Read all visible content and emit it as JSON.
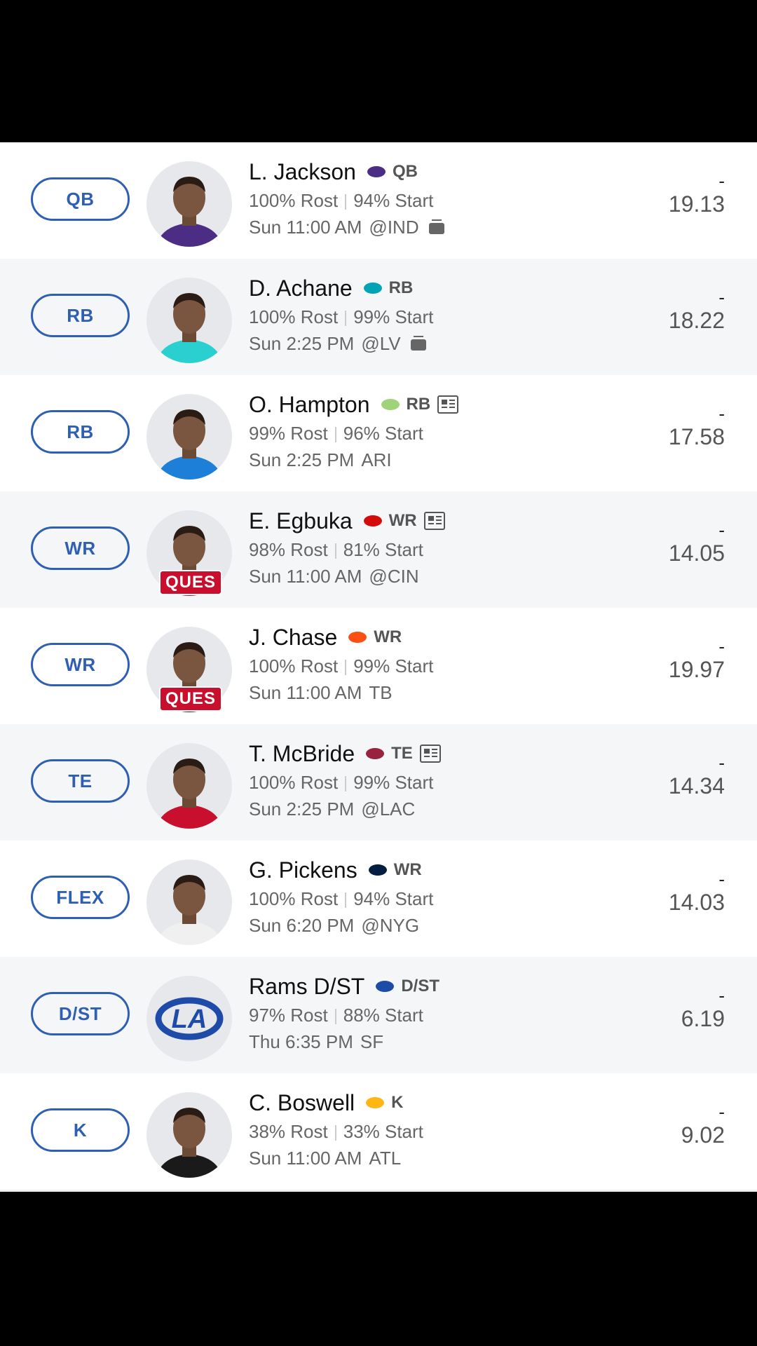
{
  "players": [
    {
      "slot": "QB",
      "name": "L. Jackson",
      "team_icon": "ravens-logo-icon",
      "team_color": "#4b2e83",
      "pos": "QB",
      "news": false,
      "rost": "100% Rost",
      "start": "94% Start",
      "time": "Sun 11:00 AM",
      "opp": "@IND",
      "tv": true,
      "status": "",
      "dash": "-",
      "proj": "19.13",
      "jersey": "#4b2e83"
    },
    {
      "slot": "RB",
      "name": "D. Achane",
      "team_icon": "dolphins-logo-icon",
      "team_color": "#00a4b4",
      "pos": "RB",
      "news": false,
      "rost": "100% Rost",
      "start": "99% Start",
      "time": "Sun 2:25 PM",
      "opp": "@LV",
      "tv": true,
      "status": "",
      "dash": "-",
      "proj": "18.22",
      "jersey": "#2ad0d0"
    },
    {
      "slot": "RB",
      "name": "O. Hampton",
      "team_icon": "chargers-logo-icon",
      "team_color": "#9fd37a",
      "pos": "RB",
      "news": true,
      "rost": "99% Rost",
      "start": "96% Start",
      "time": "Sun 2:25 PM",
      "opp": "ARI",
      "tv": false,
      "status": "",
      "dash": "-",
      "proj": "17.58",
      "jersey": "#1e7fd8"
    },
    {
      "slot": "WR",
      "name": "E. Egbuka",
      "team_icon": "buccaneers-logo-icon",
      "team_color": "#d50a0a",
      "pos": "WR",
      "news": true,
      "rost": "98% Rost",
      "start": "81% Start",
      "time": "Sun 11:00 AM",
      "opp": "@CIN",
      "tv": false,
      "status": "QUES",
      "dash": "-",
      "proj": "14.05",
      "jersey": "#b5121b"
    },
    {
      "slot": "WR",
      "name": "J. Chase",
      "team_icon": "bengals-logo-icon",
      "team_color": "#fb4f14",
      "pos": "WR",
      "news": false,
      "rost": "100% Rost",
      "start": "99% Start",
      "time": "Sun 11:00 AM",
      "opp": "TB",
      "tv": false,
      "status": "QUES",
      "dash": "-",
      "proj": "19.97",
      "jersey": "#222222"
    },
    {
      "slot": "TE",
      "name": "T. McBride",
      "team_icon": "cardinals-logo-icon",
      "team_color": "#97233f",
      "pos": "TE",
      "news": true,
      "rost": "100% Rost",
      "start": "99% Start",
      "time": "Sun 2:25 PM",
      "opp": "@LAC",
      "tv": false,
      "status": "",
      "dash": "-",
      "proj": "14.34",
      "jersey": "#c8102e"
    },
    {
      "slot": "FLEX",
      "name": "G. Pickens",
      "team_icon": "cowboys-star-icon",
      "team_color": "#041e42",
      "pos": "WR",
      "news": false,
      "rost": "100% Rost",
      "start": "94% Start",
      "time": "Sun 6:20 PM",
      "opp": "@NYG",
      "tv": false,
      "status": "",
      "dash": "-",
      "proj": "14.03",
      "jersey": "#f0f0f0"
    },
    {
      "slot": "D/ST",
      "name": "Rams D/ST",
      "team_icon": "rams-logo-icon",
      "team_color": "#1e4ba8",
      "pos": "D/ST",
      "news": false,
      "rost": "97% Rost",
      "start": "88% Start",
      "time": "Thu 6:35 PM",
      "opp": "SF",
      "tv": false,
      "status": "",
      "dash": "-",
      "proj": "6.19",
      "jersey": ""
    },
    {
      "slot": "K",
      "name": "C. Boswell",
      "team_icon": "steelers-logo-icon",
      "team_color": "#ffb612",
      "pos": "K",
      "news": false,
      "rost": "38% Rost",
      "start": "33% Start",
      "time": "Sun 11:00 AM",
      "opp": "ATL",
      "tv": false,
      "status": "",
      "dash": "-",
      "proj": "9.02",
      "jersey": "#1a1a1a"
    }
  ]
}
